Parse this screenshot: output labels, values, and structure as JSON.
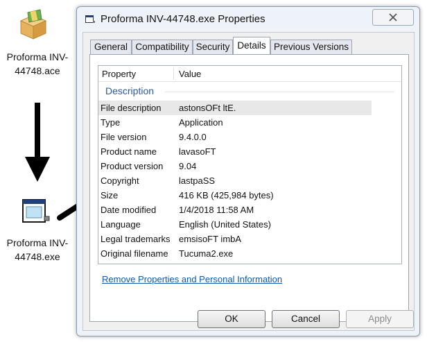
{
  "desktop": {
    "file1": {
      "label": "Proforma INV-44748.ace",
      "icon": "package-icon"
    },
    "file2": {
      "label": "Proforma INV-44748.exe",
      "icon": "executable-icon"
    }
  },
  "dialog": {
    "title": "Proforma INV-44748.exe Properties",
    "tabs": [
      {
        "label": "General",
        "active": false
      },
      {
        "label": "Compatibility",
        "active": false
      },
      {
        "label": "Security",
        "active": false
      },
      {
        "label": "Details",
        "active": true
      },
      {
        "label": "Previous Versions",
        "active": false
      }
    ],
    "columns": {
      "property": "Property",
      "value": "Value"
    },
    "group_label": "Description",
    "rows": [
      {
        "key": "File description",
        "value": "astonsOFt ltE.",
        "selected": true
      },
      {
        "key": "Type",
        "value": "Application"
      },
      {
        "key": "File version",
        "value": "9.4.0.0"
      },
      {
        "key": "Product name",
        "value": "lavasoFT"
      },
      {
        "key": "Product version",
        "value": "9.04"
      },
      {
        "key": "Copyright",
        "value": "lastpaSS"
      },
      {
        "key": "Size",
        "value": "416 KB (425,984 bytes)"
      },
      {
        "key": "Date modified",
        "value": "1/4/2018 11:58 AM"
      },
      {
        "key": "Language",
        "value": "English (United States)"
      },
      {
        "key": "Legal trademarks",
        "value": "emsisoFT imbA"
      },
      {
        "key": "Original filename",
        "value": "Tucuma2.exe"
      }
    ],
    "remove_link": "Remove Properties and Personal Information",
    "buttons": {
      "ok": "OK",
      "cancel": "Cancel",
      "apply": "Apply"
    }
  },
  "colors": {
    "link": "#0b5ab3",
    "group_heading": "#2b5aa8",
    "dialog_frame": "#eef3f9"
  }
}
